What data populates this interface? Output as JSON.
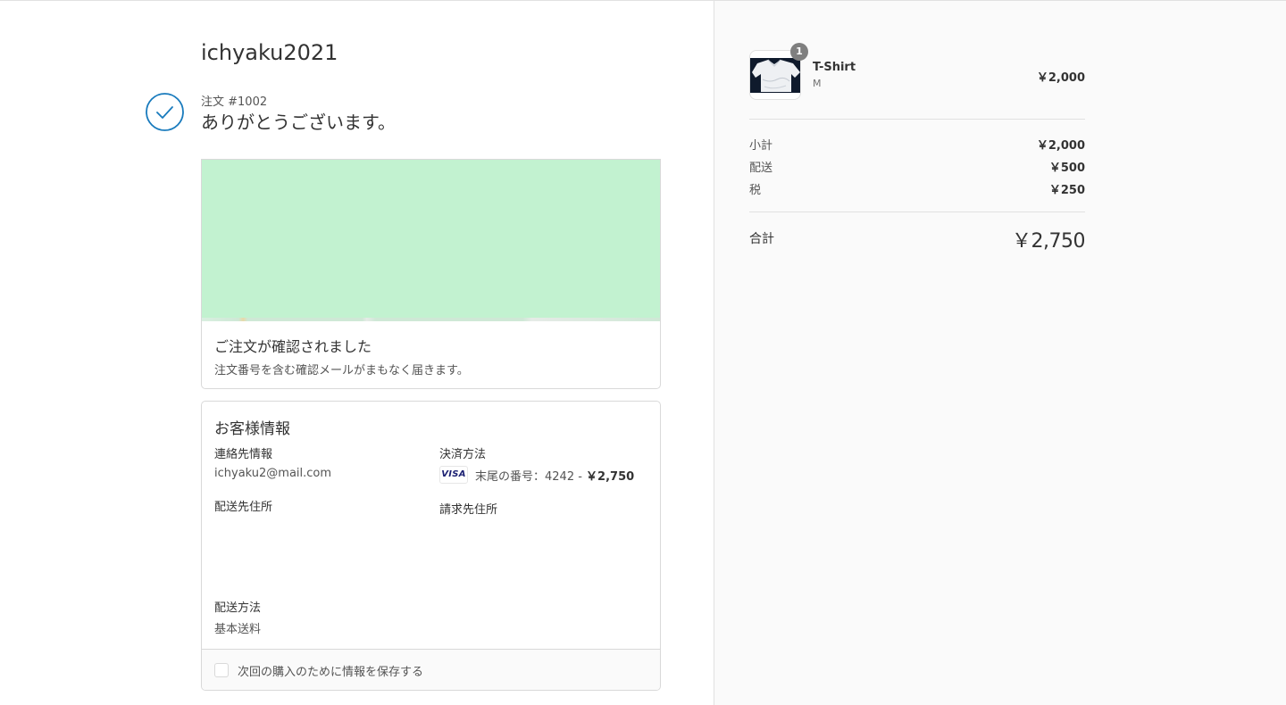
{
  "store": {
    "name": "ichyaku2021"
  },
  "order": {
    "number_label": "注文 #1002",
    "thank_you": "ありがとうございます。"
  },
  "confirmation": {
    "title": "ご注文が確認されました",
    "message": "注文番号を含む確認メールがまもなく届きます。"
  },
  "customer": {
    "title": "お客様情報",
    "contact_label": "連絡先情報",
    "contact_value": "ichyaku2@mail.com",
    "payment_label": "決済方法",
    "card_brand": "VISA",
    "payment_text": "末尾の番号：4242 - ",
    "payment_amount": "￥2,750",
    "shipping_address_label": "配送先住所",
    "billing_address_label": "請求先住所",
    "shipping_method_label": "配送方法",
    "shipping_method_value": "基本送料",
    "save_info_label": "次回の購入のために情報を保存する",
    "save_info_checked": false
  },
  "summary": {
    "product": {
      "name": "T-Shirt",
      "variant": "M",
      "quantity": "1",
      "price": "￥2,000"
    },
    "subtotal_label": "小計",
    "subtotal_value": "￥2,000",
    "shipping_label": "配送",
    "shipping_value": "￥500",
    "tax_label": "税",
    "tax_value": "￥250",
    "total_label": "合計",
    "total_value": "￥2,750"
  },
  "colors": {
    "accent": "#197bbd",
    "map_fill": "#c2f2d0",
    "sidebar_bg": "#fafafa"
  }
}
